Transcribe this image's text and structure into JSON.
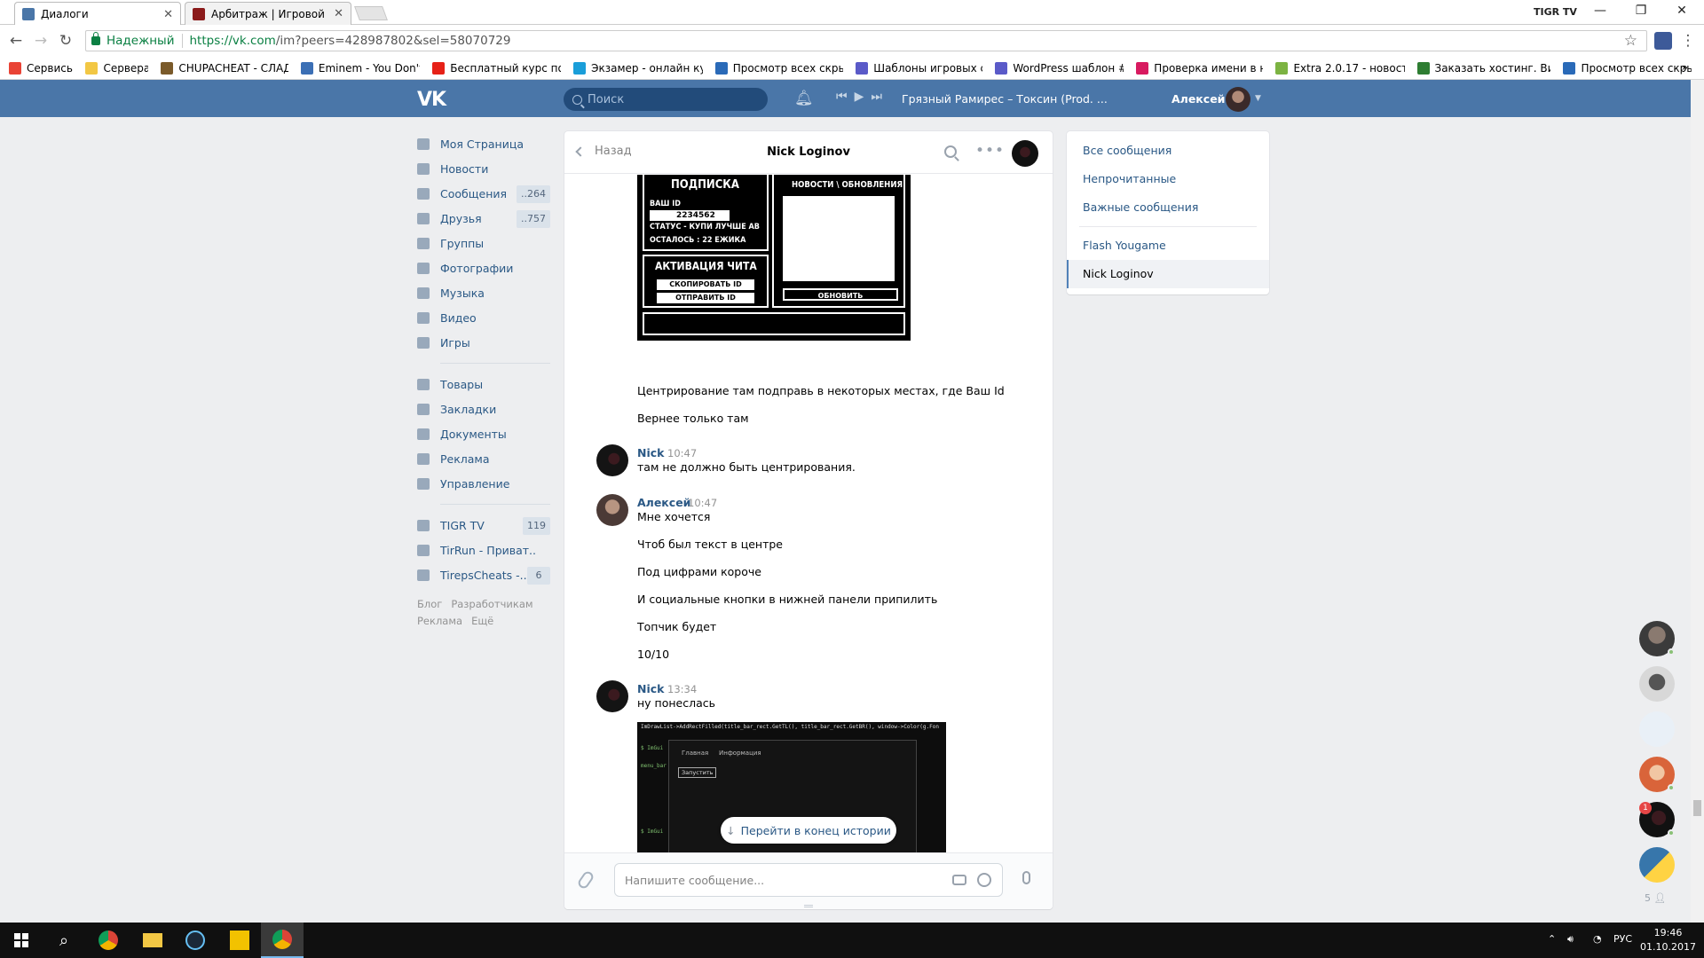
{
  "browser": {
    "tabs": [
      {
        "title": "Диалоги",
        "active": true,
        "color": "#4a76a8"
      },
      {
        "title": "Арбитраж | Игровой фо",
        "active": false,
        "color": "#8b1a1a"
      }
    ],
    "window_label": "TIGR TV",
    "secure_label": "Надежный",
    "url_host": "https://vk.com",
    "url_path": "/im?peers=428987802&sel=58070729",
    "bookmarks": [
      {
        "label": "Сервисы",
        "color": "#e94335"
      },
      {
        "label": "Сервера",
        "color": "#f2c744"
      },
      {
        "label": "CHUPACHEAT - СЛАД",
        "color": "#7a5a2a"
      },
      {
        "label": "Eminem - You Don't",
        "color": "#3b6fb5"
      },
      {
        "label": "Бесплатный курс по",
        "color": "#e62117"
      },
      {
        "label": "Экзамер - онлайн ку",
        "color": "#1a9ed9"
      },
      {
        "label": "Просмотр всех скры",
        "color": "#2a6ab8"
      },
      {
        "label": "Шаблоны игровых с",
        "color": "#5a5ac8"
      },
      {
        "label": "WordPress шаблон #",
        "color": "#5a5ac8"
      },
      {
        "label": "Проверка имени в н",
        "color": "#d81b60"
      },
      {
        "label": "Extra 2.0.17 - новост",
        "color": "#7cb342"
      },
      {
        "label": "Заказать хостинг. Ви",
        "color": "#2e7d32"
      },
      {
        "label": "Просмотр всех скры",
        "color": "#2a6ab8"
      }
    ],
    "bookmarks_more": "»"
  },
  "vk_header": {
    "logo": "VK",
    "search_placeholder": "Поиск",
    "track": "Грязный Рамирес – Токсин (Prod. ...",
    "user_name": "Алексей"
  },
  "left_menu": {
    "main": [
      {
        "label": "Моя Страница",
        "badge": ""
      },
      {
        "label": "Новости",
        "badge": ""
      },
      {
        "label": "Сообщения",
        "badge": "..264"
      },
      {
        "label": "Друзья",
        "badge": "..757"
      },
      {
        "label": "Группы",
        "badge": ""
      },
      {
        "label": "Фотографии",
        "badge": ""
      },
      {
        "label": "Музыка",
        "badge": ""
      },
      {
        "label": "Видео",
        "badge": ""
      },
      {
        "label": "Игры",
        "badge": ""
      }
    ],
    "extra": [
      {
        "label": "Товары"
      },
      {
        "label": "Закладки"
      },
      {
        "label": "Документы"
      },
      {
        "label": "Реклама"
      },
      {
        "label": "Управление"
      }
    ],
    "groups": [
      {
        "label": "TIGR TV",
        "badge": "119"
      },
      {
        "label": "TirRun - Приват..",
        "badge": ""
      },
      {
        "label": "TirepsCheats -..",
        "badge": "6"
      }
    ],
    "footer": [
      "Блог",
      "Разработчикам",
      "Реклама",
      "Ещё"
    ]
  },
  "chat": {
    "back_label": "Назад",
    "title": "Nick Loginov",
    "image1": {
      "sub_title": "ПОДПИСКА",
      "id_label": "ВАШ ID",
      "id_value": "2234562",
      "status": "СТАТУС - КУПИ ЛУЧШЕ АВ",
      "left": "ОСТАЛОСЬ : 22 ЕЖИКА",
      "news_title": "НОВОСТИ \\ ОБНОВЛЕНИЯ",
      "activation_title": "АКТИВАЦИЯ ЧИТА",
      "copy_id": "СКОПИРОВАТЬ ID",
      "send_id": "ОТПРАВИТЬ ID",
      "refresh": "ОБНОВИТЬ"
    },
    "messages": [
      {
        "text": "Центрирование там подправь в некоторых местах, где Ваш Id"
      },
      {
        "text": "Вернее только там"
      },
      {
        "author": "Nick",
        "time": "10:47",
        "text": "там не должно быть центрирования."
      },
      {
        "author": "Алексей",
        "time": "10:47",
        "text": "Мне хочется"
      },
      {
        "text": "Чтоб был текст в центре"
      },
      {
        "text": "Под цифрами короче"
      },
      {
        "text": "И социальные кнопки в нижней панели припилить"
      },
      {
        "text": "Топчик будет"
      },
      {
        "text": "10/10"
      },
      {
        "author": "Nick",
        "time": "13:34",
        "text": "ну понеслась"
      }
    ],
    "image2": {
      "code_line": "ImDrawList->AddRectFilled(title_bar_rect.GetTL(), title_bar_rect.GetBR(), window->Color(g.Fon",
      "tab1": "Главная",
      "tab2": "Информация",
      "button": "Запустить"
    },
    "jump_label": "Перейти в конец истории",
    "composer_placeholder": "Напишите сообщение..."
  },
  "right_menu": {
    "items": [
      "Все сообщения",
      "Непрочитанные",
      "Важные сообщения"
    ],
    "dialogs": [
      "Flash Yougame",
      "Nick Loginov"
    ]
  },
  "floating": {
    "notification_count": "1",
    "online_count": "5"
  },
  "taskbar": {
    "language": "РУС",
    "time": "19:46",
    "date": "01.10.2017"
  }
}
